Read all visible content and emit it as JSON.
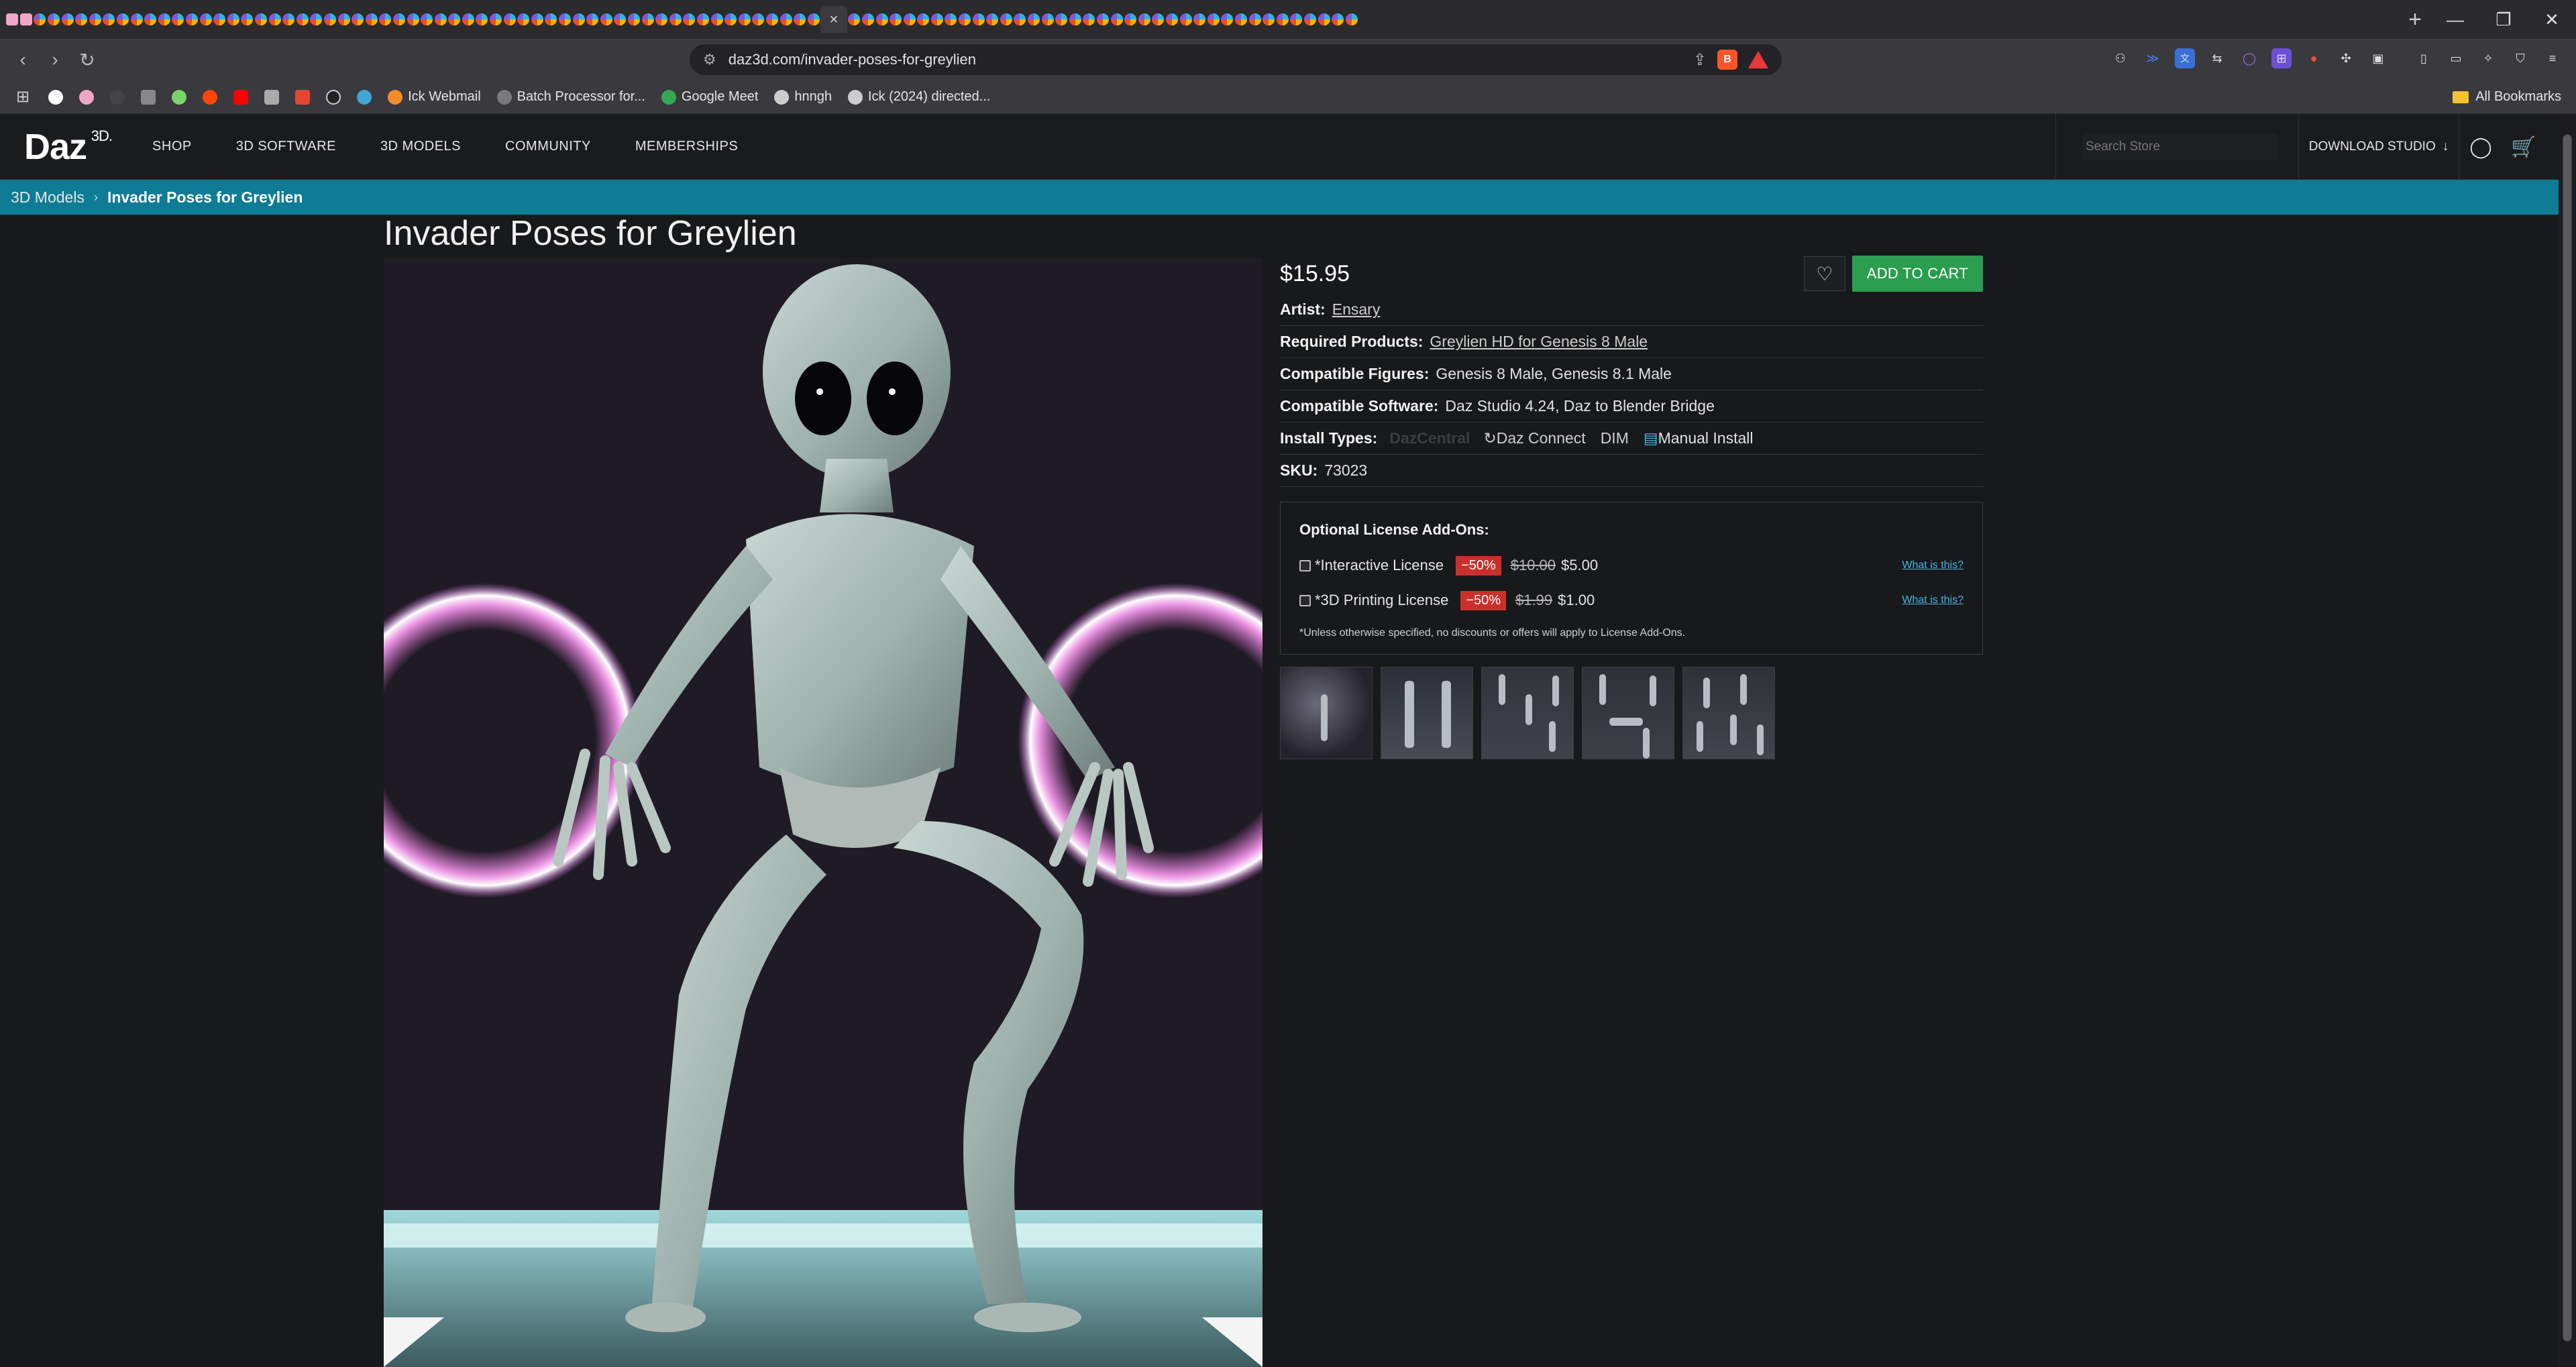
{
  "browser": {
    "active_tab_close": "×",
    "new_tab": "+",
    "url_site_icon": "⚙",
    "url": "daz3d.com/invader-poses-for-greylien",
    "bookmarks": [
      {
        "label": "Ick Webmail",
        "color": "#f28c28"
      },
      {
        "label": "Batch Processor for...",
        "color": "#7a7a7a"
      },
      {
        "label": "Google Meet",
        "color": "#34a853"
      },
      {
        "label": "hnngh",
        "color": "#cccccc"
      },
      {
        "label": "Ick (2024) directed...",
        "color": "#cccccc"
      }
    ],
    "all_bookmarks": "All Bookmarks"
  },
  "site": {
    "logo": "Daz",
    "logo_sup": "3D.",
    "nav": [
      "SHOP",
      "3D SOFTWARE",
      "3D MODELS",
      "COMMUNITY",
      "MEMBERSHIPS"
    ],
    "search_placeholder": "Search Store",
    "download_label": "DOWNLOAD STUDIO",
    "download_arrow": "↓"
  },
  "breadcrumb": {
    "parent": "3D Models",
    "separator": "›",
    "current": "Invader Poses for Greylien"
  },
  "product": {
    "title": "Invader Poses for Greylien",
    "price": "$15.95",
    "wishlist_icon": "♡",
    "add_to_cart": "ADD TO CART",
    "artist_label": "Artist:",
    "artist": "Ensary",
    "required_label": "Required Products:",
    "required": "Greylien HD for Genesis 8 Male",
    "figures_label": "Compatible Figures:",
    "figures": "Genesis 8 Male, Genesis 8.1 Male",
    "software_label": "Compatible Software:",
    "software": "Daz Studio 4.24, Daz to Blender Bridge",
    "install_label": "Install Types:",
    "install_dazcentral": "DazCentral",
    "install_connect": "Daz Connect",
    "install_dim": "DIM",
    "install_manual": "Manual Install",
    "sku_label": "SKU:",
    "sku": "73023"
  },
  "licenses": {
    "heading": "Optional License Add-Ons:",
    "items": [
      {
        "name": "*Interactive License",
        "discount": "−50%",
        "old_price": "$10.00",
        "new_price": "$5.00",
        "help": "What is this?"
      },
      {
        "name": "*3D Printing License",
        "discount": "−50%",
        "old_price": "$1.99",
        "new_price": "$1.00",
        "help": "What is this?"
      }
    ],
    "note": "*Unless otherwise specified, no discounts or offers will apply to License Add-Ons."
  }
}
